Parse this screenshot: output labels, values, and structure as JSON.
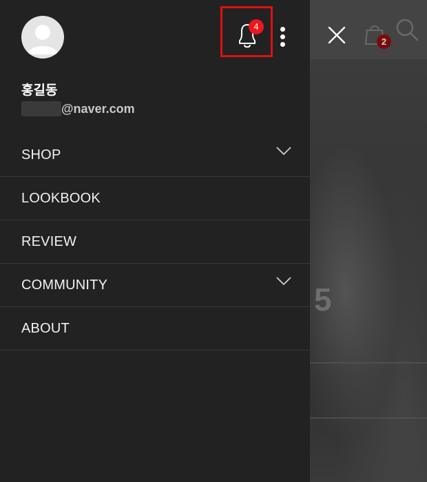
{
  "profile": {
    "name": "홍길동",
    "email_domain": "@naver.com"
  },
  "notifications": {
    "count": "4",
    "highlighted": true,
    "highlight_color": "#e01010",
    "badge_color": "#f0141e"
  },
  "menu": {
    "items": [
      {
        "label": "SHOP",
        "expandable": true
      },
      {
        "label": "LOOKBOOK",
        "expandable": false
      },
      {
        "label": "REVIEW",
        "expandable": false
      },
      {
        "label": "COMMUNITY",
        "expandable": true
      },
      {
        "label": "ABOUT",
        "expandable": false
      }
    ]
  },
  "background_page": {
    "cart_count": "2",
    "visible_digit": "5"
  },
  "icons": {
    "bell": "bell-icon",
    "more": "more-vertical-icon",
    "close": "close-icon",
    "cart": "shopping-bag-icon",
    "search": "search-icon",
    "avatar": "user-avatar-icon",
    "chevron": "chevron-down-icon"
  },
  "colors": {
    "drawer_bg": "#222222",
    "divider": "#3a3a3a",
    "text": "#f2f2f2",
    "cart_badge": "#7a0b0b"
  }
}
